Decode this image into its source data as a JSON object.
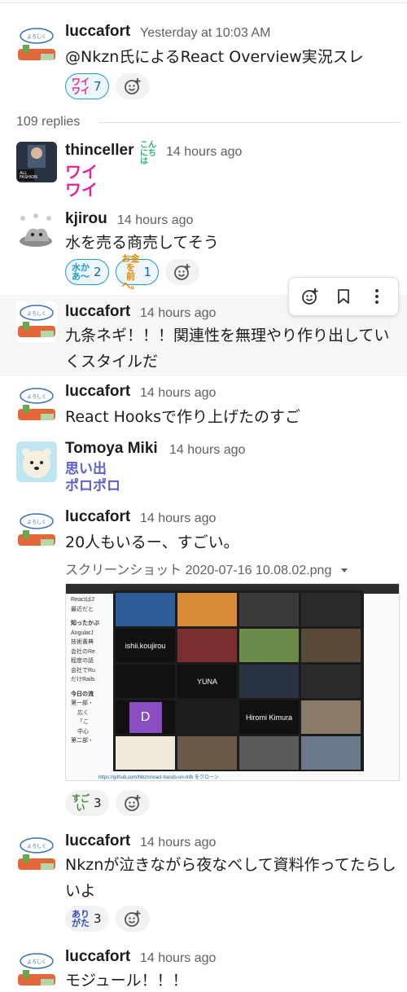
{
  "thread": {
    "replies_label": "109 replies"
  },
  "messages": [
    {
      "author": "luccafort",
      "time": "Yesterday at 10:03 AM",
      "text": "@Nkzn氏によるReact Overview実況スレ",
      "reactions": [
        {
          "emoji": "ワイ ワイ",
          "count": "7",
          "active": true
        }
      ]
    },
    {
      "author": "thinceller",
      "status_emoji": "こんにちは",
      "time": "14 hours ago",
      "big_emoji": [
        "ワイ",
        "ワイ"
      ]
    },
    {
      "author": "kjirou",
      "time": "14 hours ago",
      "text": "水を売る商売してそう",
      "reactions": [
        {
          "emoji": "水か あ〜",
          "count": "2",
          "active": true
        },
        {
          "emoji": "お金を 前へ。",
          "count": "1",
          "active": true
        }
      ]
    },
    {
      "author": "luccafort",
      "time": "14 hours ago",
      "text": "九条ネギ！！！関連性を無理やり作り出していくスタイルだ"
    },
    {
      "author": "luccafort",
      "time": "14 hours ago",
      "text": "React Hooksで作り上げたのすご"
    },
    {
      "author": "Tomoya Miki",
      "time": "14 hours ago",
      "big_emoji": [
        "思い出",
        "ポロポロ"
      ]
    },
    {
      "author": "luccafort",
      "time": "14 hours ago",
      "text": "20人もいるー、すごい。",
      "file": {
        "name": "スクリーンショット 2020-07-16 10.08.02.png"
      },
      "reactions": [
        {
          "emoji": "すご い",
          "count": "3",
          "active": false
        }
      ]
    },
    {
      "author": "luccafort",
      "time": "14 hours ago",
      "text": "Nkznが泣きながら夜なべして資料作ってたらしいよ",
      "reactions": [
        {
          "emoji": "あり がた",
          "count": "3",
          "active": false
        }
      ]
    },
    {
      "author": "luccafort",
      "time": "14 hours ago",
      "text": "モジュール！！！"
    }
  ],
  "screenshot": {
    "participants": [
      "ishii.koujirou",
      "YUNA",
      "Hiromi Kimura",
      "D"
    ],
    "doc_lines": [
      "Reactは2",
      "最近だと",
      "知ったかぶ",
      "AngularJ",
      "技術書典",
      "会社のRe",
      "程度の話",
      "会社でRu",
      "だけRails",
      "今日の流",
      "第一部・",
      "広く",
      "「こ",
      "中心",
      "第二部・",
      "https://github.com/Nkzn/react-hands-on-mfk をクローン"
    ]
  },
  "colors": {
    "accent": "#1264a3",
    "active_reaction_bg": "#eef6fb",
    "emoji_pink": "#e0249a",
    "emoji_purple": "#5b5fc7"
  }
}
